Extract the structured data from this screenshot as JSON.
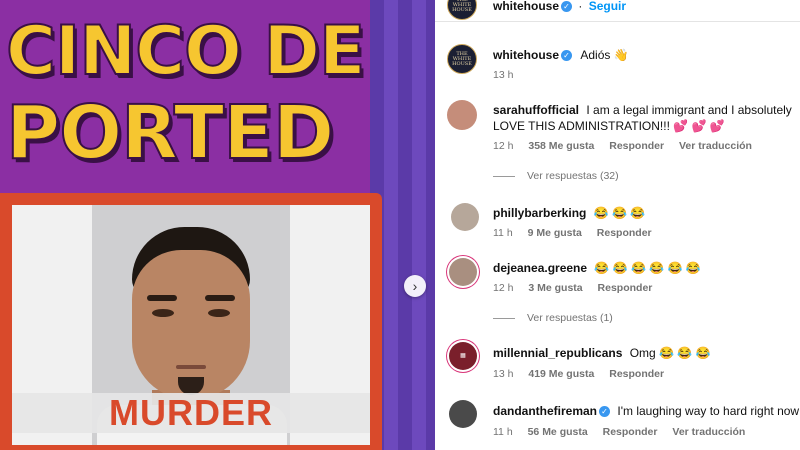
{
  "post": {
    "title_line1": "CINCO DE",
    "title_line2": "PORTED",
    "caption": "MURDER",
    "next_arrow": "›"
  },
  "header": {
    "username": "whitehouse",
    "follow_label": "Seguir",
    "avatar_text": "THE WHITE HOUSE"
  },
  "caption_comment": {
    "username": "whitehouse",
    "text": "Adiós 👋",
    "time": "13 h",
    "avatar_text": "THE WHITE HOUSE"
  },
  "comments": [
    {
      "username": "sarahuffofficial",
      "verified": false,
      "text": "I am a legal immigrant and I absolutely LOVE THIS ADMINISTRATION!!! 💕 💕 💕",
      "time": "12 h",
      "likes": "358 Me gusta",
      "reply": "Responder",
      "translate": "Ver traducción",
      "view_replies": "Ver respuestas (32)"
    },
    {
      "username": "phillybarberking",
      "verified": false,
      "text": "😂 😂 😂",
      "time": "11 h",
      "likes": "9 Me gusta",
      "reply": "Responder"
    },
    {
      "username": "dejeanea.greene",
      "verified": false,
      "text": "😂 😂 😂 😂 😂 😂",
      "time": "12 h",
      "likes": "3 Me gusta",
      "reply": "Responder",
      "view_replies": "Ver respuestas (1)"
    },
    {
      "username": "millennial_republicans",
      "verified": false,
      "text": "Omg 😂 😂 😂",
      "time": "13 h",
      "likes": "419 Me gusta",
      "reply": "Responder"
    },
    {
      "username": "dandanthefireman",
      "verified": true,
      "text": "I'm laughing way to hard right now",
      "time": "11 h",
      "likes": "56 Me gusta",
      "reply": "Responder",
      "translate": "Ver traducción"
    }
  ],
  "colors": {
    "post_bg": "#8b2fa3",
    "title_yellow": "#f6c630",
    "frame_red": "#d94a2b",
    "verified_blue": "#3897f0",
    "link_blue": "#0095f6"
  }
}
